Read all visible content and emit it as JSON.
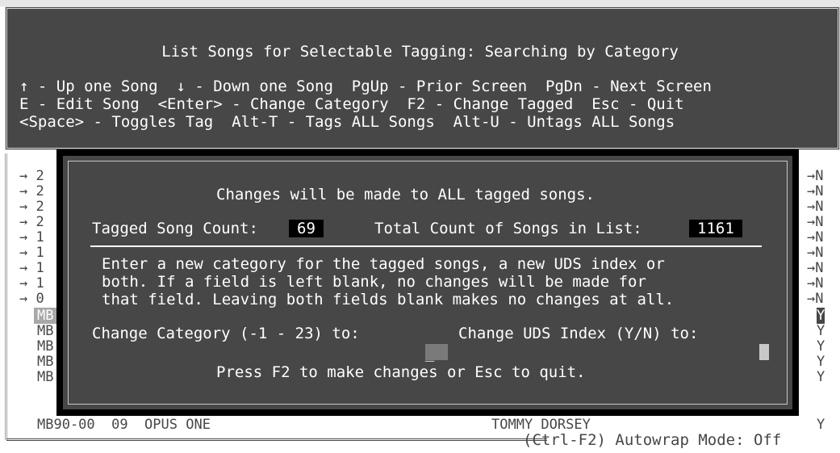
{
  "header": {
    "title": "List Songs for Selectable Tagging: Searching by Category",
    "help_lines": [
      "↑ - Up one Song  ↓ - Down one Song  PgUp - Prior Screen  PgDn - Next Screen",
      "E - Edit Song  <Enter> - Change Category  F2 - Change Tagged  Esc - Quit",
      "<Space> - Toggles Tag  Alt-T - Tags ALL Songs  Alt-U - Untags ALL Songs"
    ]
  },
  "list": {
    "left_rows": [
      "→ 2",
      "→ 2",
      "→ 2",
      "→ 2",
      "→ 1",
      "→ 1",
      "→ 1",
      "→ 1",
      "→ 0"
    ],
    "right_rows": [
      "→N",
      "→N",
      "→N",
      "→N",
      "→N",
      "→N",
      "→N",
      "→N",
      "→N"
    ],
    "mb_rows": [
      "MB",
      "MB",
      "MB",
      "MB",
      "MB"
    ],
    "y_rows": [
      "Y",
      "Y",
      "Y",
      "Y",
      "Y"
    ],
    "last_row": {
      "code": "MB90-00  09  OPUS ONE",
      "artist": "TOMMY DORSEY",
      "flag": "Y"
    }
  },
  "status": {
    "autowrap": "(Ctrl-F2) Autowrap Mode: Off"
  },
  "dialog": {
    "heading": "Changes will be made to ALL tagged songs.",
    "tagged_label": "Tagged Song Count:",
    "tagged_value": "69",
    "total_label": "Total Count of Songs in List:",
    "total_value": "1161",
    "instructions": [
      "Enter a new category for the tagged songs, a new UDS index or",
      "both. If a field is left blank, no changes will be made for",
      "that field. Leaving both fields blank makes no changes at all."
    ],
    "category_label": "Change Category (-1 - 23) to:",
    "category_value": "_",
    "uds_label": "Change UDS Index (Y/N) to:",
    "uds_value": "",
    "footer": "Press F2 to make changes or Esc to quit."
  }
}
